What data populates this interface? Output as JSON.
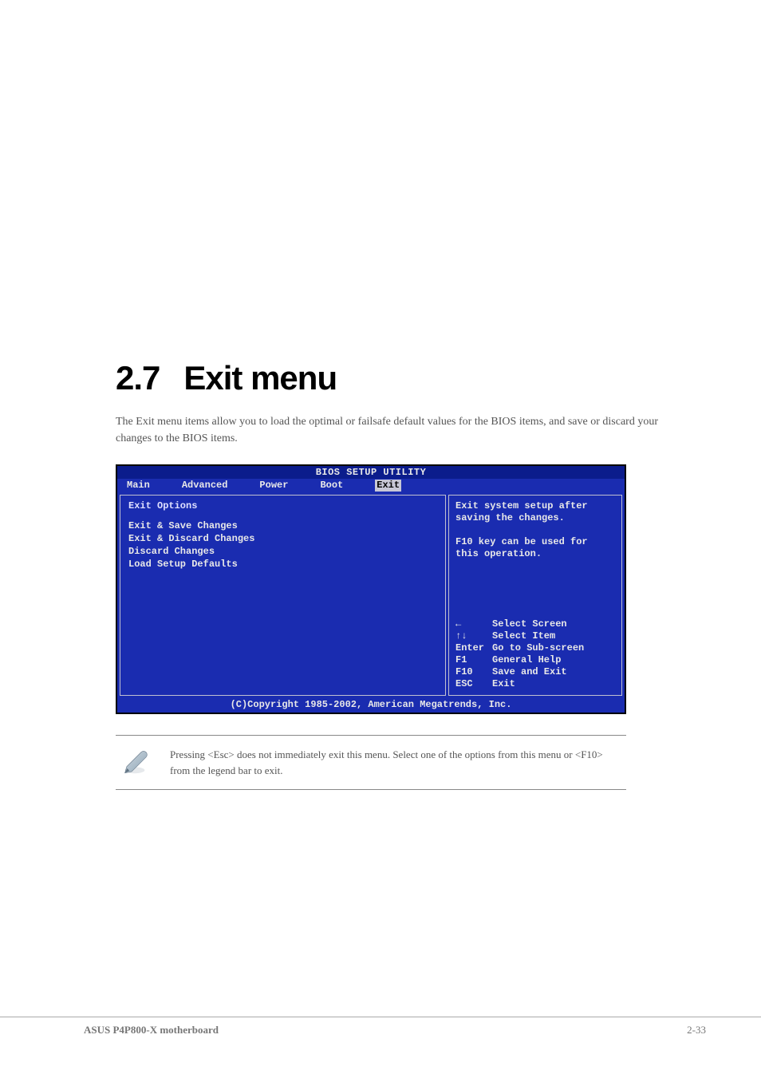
{
  "heading": {
    "number": "2.7",
    "title": "Exit menu"
  },
  "intro": "The Exit menu items allow you to load the optimal or failsafe default values for the BIOS items, and save or discard your changes to the BIOS items.",
  "bios": {
    "title": "BIOS SETUP UTILITY",
    "tabs": [
      "Main",
      "Advanced",
      "Power",
      "Boot",
      "Exit"
    ],
    "active_tab": "Exit",
    "left": {
      "heading": "Exit Options",
      "items": [
        "Exit & Save Changes",
        "Exit & Discard Changes",
        "Discard Changes",
        "",
        "Load Setup Defaults"
      ]
    },
    "right": {
      "help": "Exit system setup after saving the changes.\n\nF10 key can be used for this operation.",
      "keys": [
        {
          "k": "←",
          "d": "Select Screen"
        },
        {
          "k": "↑↓",
          "d": "Select Item"
        },
        {
          "k": "Enter",
          "d": "Go to Sub-screen"
        },
        {
          "k": "F1",
          "d": "General Help"
        },
        {
          "k": "F10",
          "d": "Save and Exit"
        },
        {
          "k": "ESC",
          "d": "Exit"
        }
      ]
    },
    "footer": "(C)Copyright 1985-2002, American Megatrends, Inc."
  },
  "note": "Pressing <Esc> does not immediately exit this menu. Select one of the options from this menu or <F10> from the legend bar to exit.",
  "page_footer": {
    "left": "ASUS P4P800-X motherboard",
    "right": "2-33"
  }
}
